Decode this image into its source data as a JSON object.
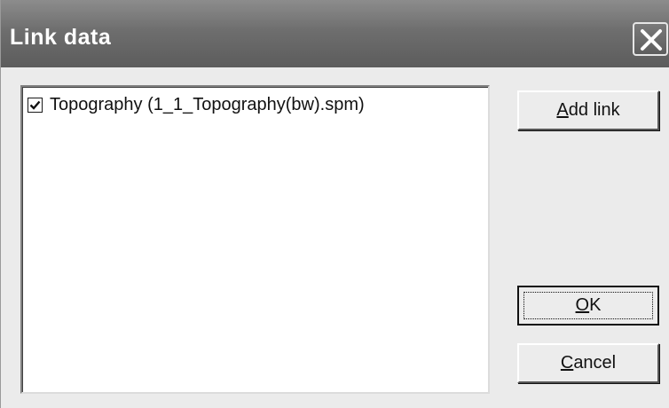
{
  "window": {
    "title": "Link data",
    "close_icon": "close-icon"
  },
  "list": {
    "items": [
      {
        "label": "Topography (1_1_Topography(bw).spm)",
        "checked": true
      }
    ]
  },
  "buttons": {
    "add_link": {
      "mnemonic": "A",
      "rest": "dd link"
    },
    "ok": {
      "mnemonic": "O",
      "rest": "K"
    },
    "cancel": {
      "mnemonic": "C",
      "rest": "ancel"
    }
  }
}
